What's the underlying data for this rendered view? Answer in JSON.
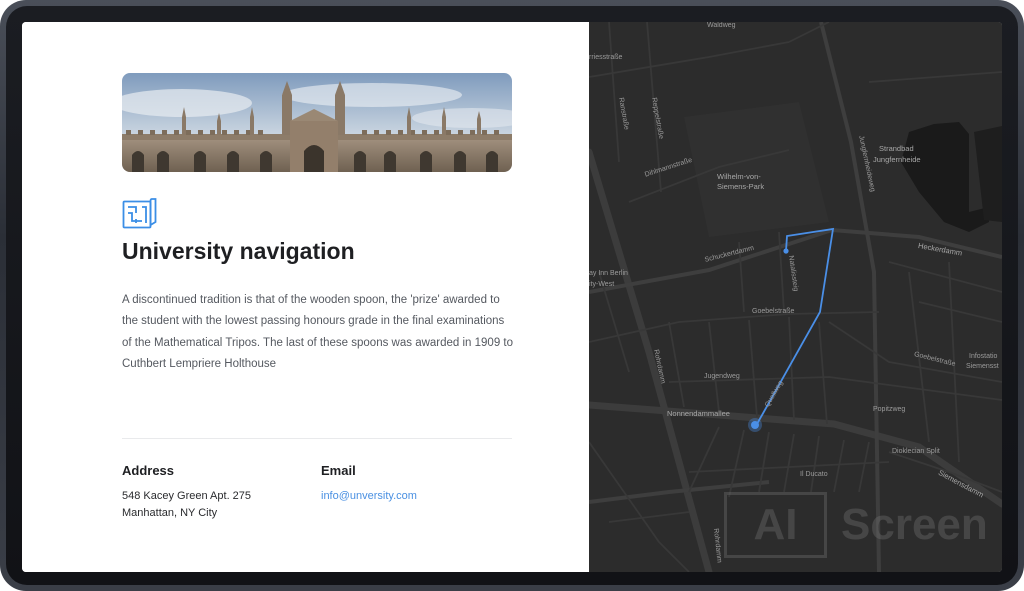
{
  "card": {
    "title": "University navigation",
    "description": "A discontinued tradition is that of the wooden spoon, the 'prize' awarded to the student with the lowest passing honours grade in the final examinations of the Mathematical Tripos. The last of these spoons was awarded in 1909 to Cuthbert Lempriere Holthouse",
    "hero_image": "university-building-photo",
    "icon": "blueprint-icon"
  },
  "contact": {
    "address_heading": "Address",
    "address_line1": "548 Kacey Green Apt. 275",
    "address_line2": "Manhattan, NY City",
    "email_heading": "Email",
    "email": "info@unversity.com"
  },
  "map": {
    "labels": {
      "waldweg": "Waldweg",
      "rieststrasse": "rriesstraße",
      "ranstrasse": "Ranstraße",
      "reppelstrasse": "Reppelstraße",
      "dihlmannstrasse": "Dihlmannstraße",
      "park1": "Wilhelm-von-",
      "park2": "Siemens-Park",
      "jungfernheideweg": "Jungfernheideweg",
      "strandbad1": "Strandbad",
      "strandbad2": "Jungfernheide",
      "schuckertdamm": "Schuckertdamm",
      "heckerdamm": "Heckerdamm",
      "natalissteig": "Natalissteig",
      "inn1": "ay Inn Berlin",
      "inn2": "ity-West",
      "goebelstrasse": "Goebelstraße",
      "goebelstrasse2": "Goebelstraße",
      "infostation1": "Infostatio",
      "infostation2": "Siemensst",
      "rohrdamm": "Rohrdamm",
      "jugendweg": "Jugendweg",
      "quellweg": "Quellweg",
      "nonnendammallee": "Nonnendammallee",
      "popitzweg": "Popitzweg",
      "dioklecian": "Dioklecian Split",
      "ilducato": "Il Ducato",
      "siemensdamm": "Siemensdamm",
      "rohrdamm2": "Rohrdamm"
    },
    "route_color": "#4a8fe7",
    "background_color": "#2c2c2c"
  },
  "watermark": {
    "box_text": "AI",
    "text": "Screen"
  }
}
